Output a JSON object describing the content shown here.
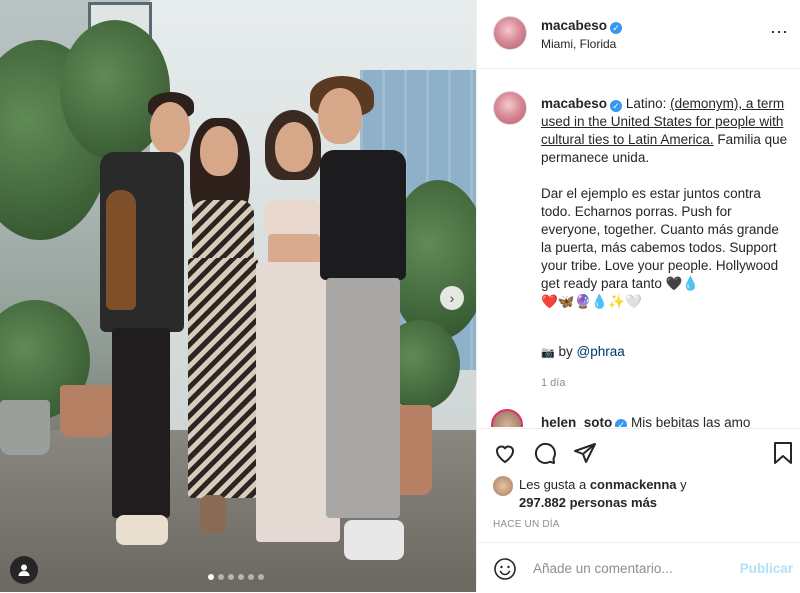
{
  "post": {
    "author": "macabeso",
    "location": "Miami, Florida",
    "more_icon": "⋯"
  },
  "caption": {
    "author": "macabeso",
    "lead": "Latino: ",
    "link": "(demonym), a term used in the United States for people with cultural ties to Latin America.",
    "after_link": " Familia que permanece unida.",
    "para2": "Dar el ejemplo es estar juntos contra todo. Echarnos porras. Push for everyone, together. Cuanto más grande la puerta, más cabemos todos. Support your tribe. Love your people. Hollywood get ready para tanto 🖤💧\n❤️🦋🔮💧✨🤍",
    "credit_prefix": "by ",
    "credit_handle": "@phraa",
    "time": "1 día"
  },
  "comment_peek": {
    "author": "helen_soto",
    "text": "Mis bebitas las amo"
  },
  "likes": {
    "line1_prefix": "Les gusta a ",
    "line1_user": "conmackenna",
    "line1_suffix": " y",
    "line2": "297.882 personas más"
  },
  "posted_time": "HACE UN DÍA",
  "add_comment": {
    "placeholder": "Añade un comentario...",
    "publish": "Publicar"
  },
  "colors": {
    "verified": "#3897f0",
    "publish_disabled": "#b2dffc"
  },
  "icons": [
    "heart-icon",
    "comment-icon",
    "share-icon",
    "bookmark-icon",
    "emoji-icon",
    "user-tag-icon",
    "camera-icon",
    "chevron-right-icon",
    "more-icon"
  ]
}
